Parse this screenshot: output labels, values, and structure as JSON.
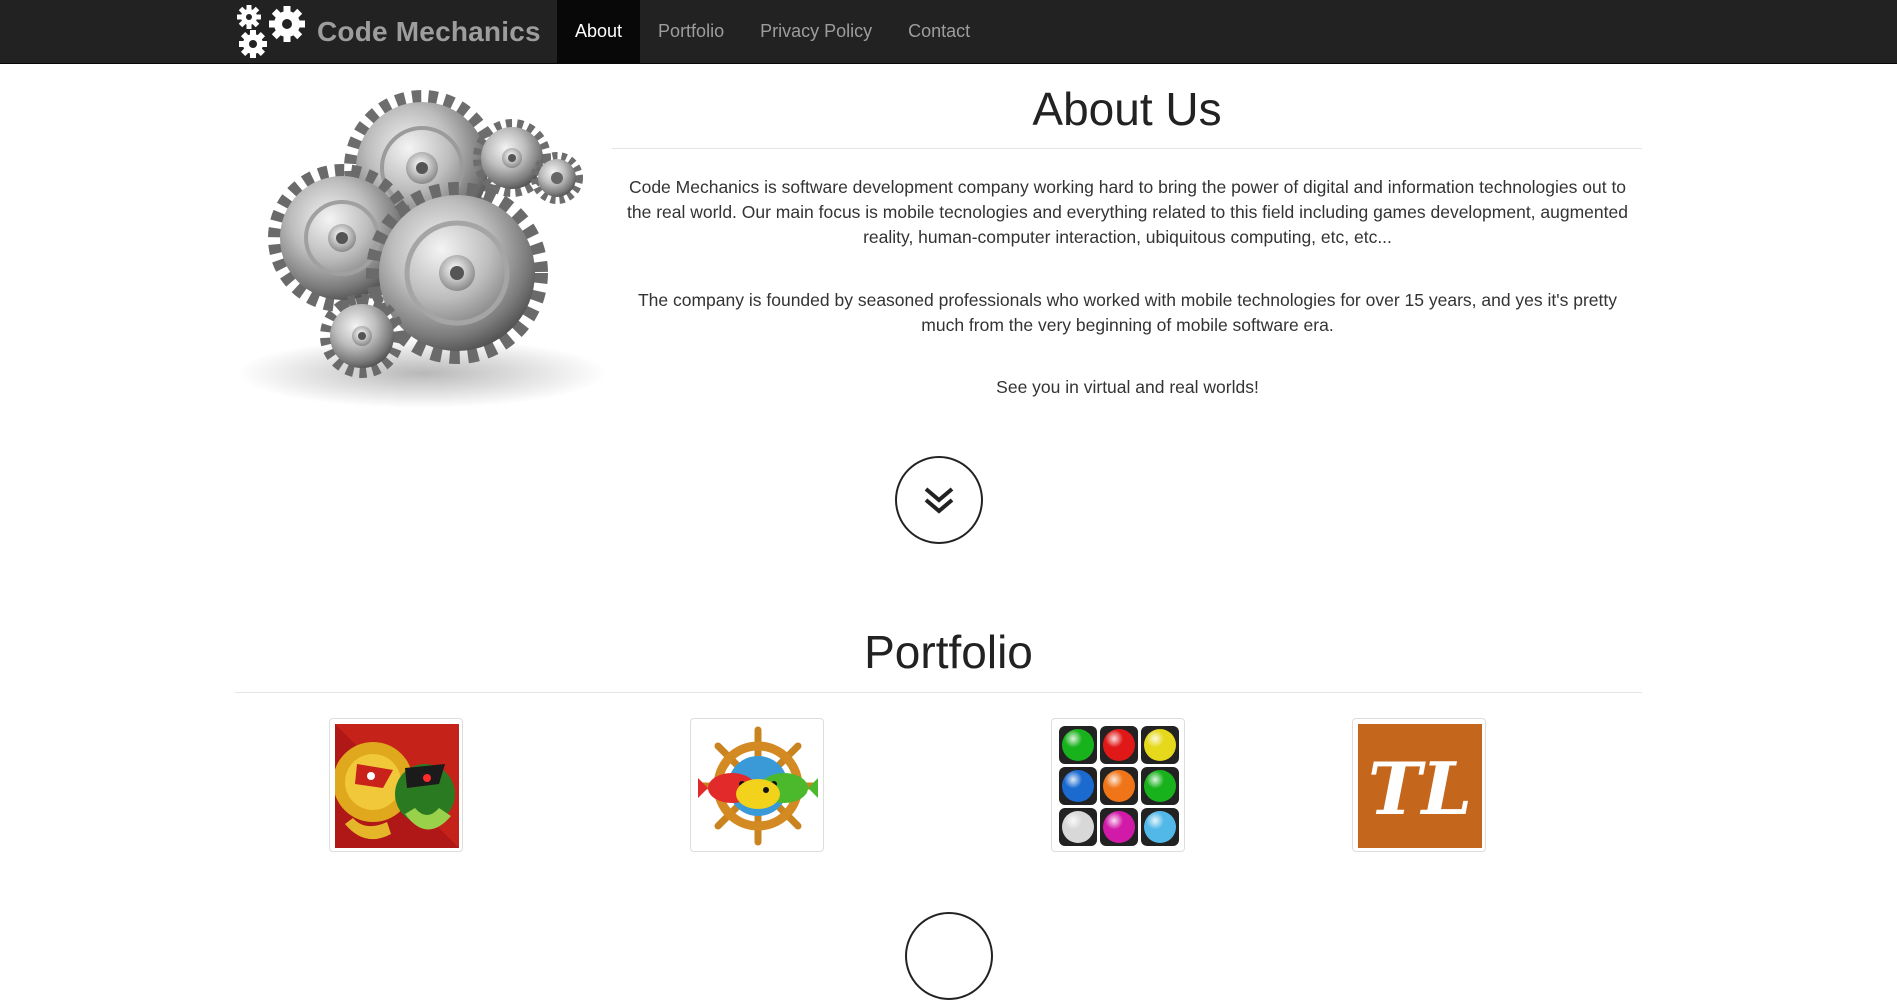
{
  "brand": {
    "name": "Code Mechanics"
  },
  "nav": {
    "items": [
      {
        "label": "About",
        "active": true
      },
      {
        "label": "Portfolio",
        "active": false
      },
      {
        "label": "Privacy Policy",
        "active": false
      },
      {
        "label": "Contact",
        "active": false
      }
    ]
  },
  "about": {
    "title": "About Us",
    "paragraphs": [
      "Code Mechanics is software development company working hard to bring the power of digital and information technologies out to the real world. Our main focus is mobile tecnologies and everything related to this field including games development, augmented reality, human-computer interaction, ubiquitous computing, etc, etc...",
      "The company is founded by seasoned professionals who worked with mobile technologies for over 15 years, and yes it's pretty much from the very beginning of mobile software era.",
      "See you in virtual and real worlds!"
    ],
    "scroll_icon": "double-chevron-down-icon"
  },
  "portfolio": {
    "title": "Portfolio",
    "apps": [
      {
        "icon": "warriors-game-icon"
      },
      {
        "icon": "fish-ship-wheel-icon"
      },
      {
        "icon": "colored-balls-grid-icon"
      },
      {
        "icon": "tl-letters-icon",
        "text": "TL"
      }
    ]
  },
  "colors": {
    "navbar": "#222222",
    "nav_active": "#080808",
    "nav_text": "#9d9d9d",
    "tl_orange": "#c4661c"
  }
}
